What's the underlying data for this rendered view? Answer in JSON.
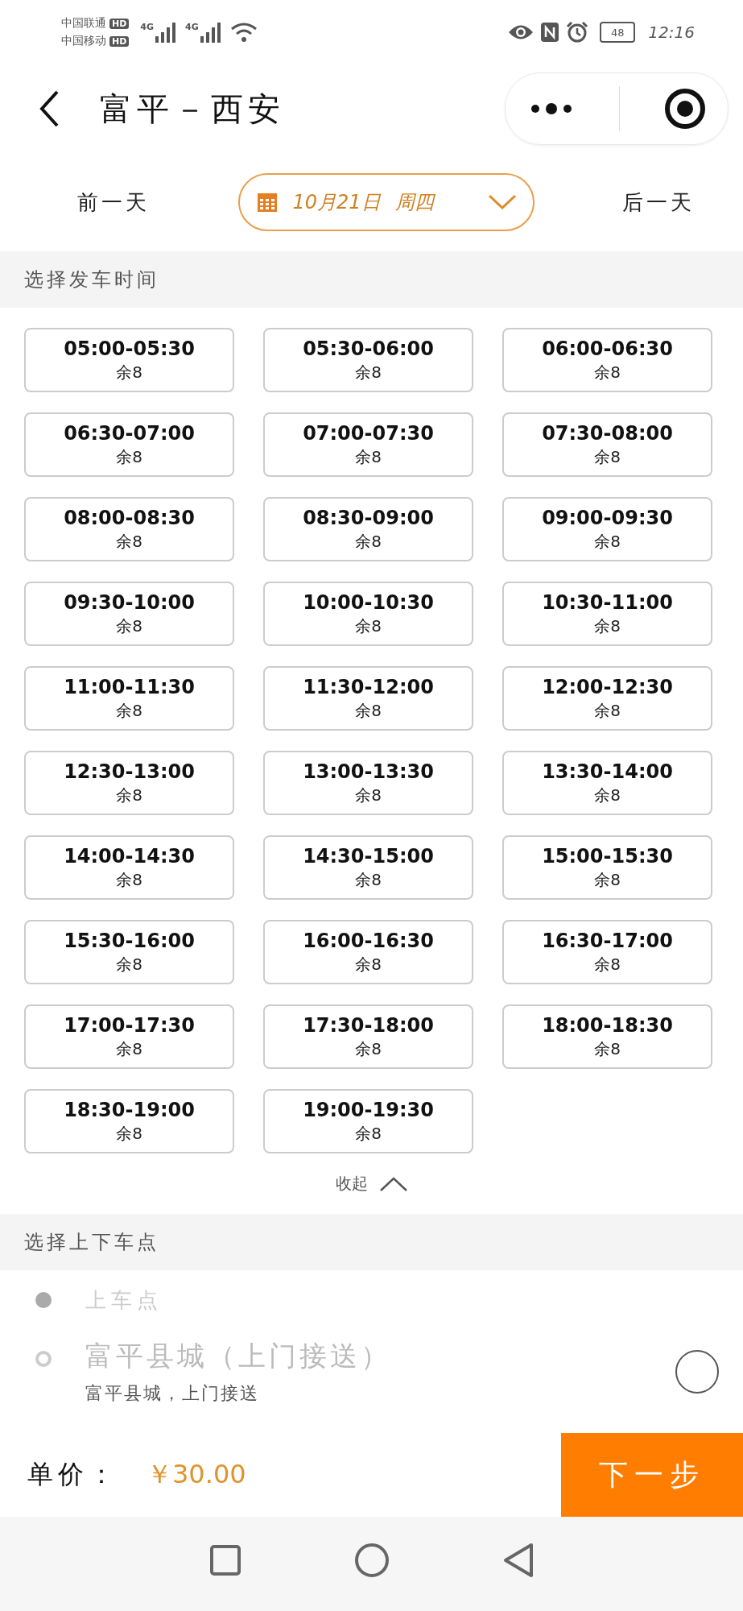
{
  "status_bar": {
    "carriers": [
      {
        "name": "中国联通",
        "badge": "HD",
        "network": "4G"
      },
      {
        "name": "中国移动",
        "badge": "HD",
        "network": "4G"
      }
    ],
    "battery": "48",
    "time": "12:16"
  },
  "header": {
    "title": "富平－西安"
  },
  "date_bar": {
    "prev": "前一天",
    "date": "10月21日",
    "weekday": "周四",
    "next": "后一天"
  },
  "time_section": {
    "title": "选择发车时间",
    "collapse": "收起",
    "slots": [
      {
        "time": "05:00-05:30",
        "remaining": "余8",
        "selected": false
      },
      {
        "time": "05:30-06:00",
        "remaining": "余8",
        "selected": false
      },
      {
        "time": "06:00-06:30",
        "remaining": "余8",
        "selected": false
      },
      {
        "time": "06:30-07:00",
        "remaining": "余8",
        "selected": false
      },
      {
        "time": "07:00-07:30",
        "remaining": "余8",
        "selected": false
      },
      {
        "time": "07:30-08:00",
        "remaining": "余8",
        "selected": false
      },
      {
        "time": "08:00-08:30",
        "remaining": "余8",
        "selected": false
      },
      {
        "time": "08:30-09:00",
        "remaining": "余8",
        "selected": false
      },
      {
        "time": "09:00-09:30",
        "remaining": "余8",
        "selected": false
      },
      {
        "time": "09:30-10:00",
        "remaining": "余8",
        "selected": false
      },
      {
        "time": "10:00-10:30",
        "remaining": "余8",
        "selected": false
      },
      {
        "time": "10:30-11:00",
        "remaining": "余8",
        "selected": false
      },
      {
        "time": "11:00-11:30",
        "remaining": "余8",
        "selected": false
      },
      {
        "time": "11:30-12:00",
        "remaining": "余8",
        "selected": false
      },
      {
        "time": "12:00-12:30",
        "remaining": "余8",
        "selected": false
      },
      {
        "time": "12:30-13:00",
        "remaining": "余8",
        "selected": false
      },
      {
        "time": "13:00-13:30",
        "remaining": "余8",
        "selected": false
      },
      {
        "time": "13:30-14:00",
        "remaining": "余8",
        "selected": false
      },
      {
        "time": "14:00-14:30",
        "remaining": "余8",
        "selected": false
      },
      {
        "time": "14:30-15:00",
        "remaining": "余8",
        "selected": false
      },
      {
        "time": "15:00-15:30",
        "remaining": "余8",
        "selected": false
      },
      {
        "time": "15:30-16:00",
        "remaining": "余8",
        "selected": false
      },
      {
        "time": "16:00-16:30",
        "remaining": "余8",
        "selected": false
      },
      {
        "time": "16:30-17:00",
        "remaining": "余8",
        "selected": false
      },
      {
        "time": "17:00-17:30",
        "remaining": "余8",
        "selected": false
      },
      {
        "time": "17:30-18:00",
        "remaining": "余8",
        "selected": false
      },
      {
        "time": "18:00-18:30",
        "remaining": "余8",
        "selected": false
      },
      {
        "time": "18:30-19:00",
        "remaining": "余8",
        "selected": false
      },
      {
        "time": "19:00-19:30",
        "remaining": "余8",
        "selected": false
      }
    ]
  },
  "stop_section": {
    "title": "选择上下车点",
    "group_label": "上车点",
    "options": [
      {
        "name": "富平县城（上门接送）",
        "detail": "富平县城，上门接送",
        "selected": false
      }
    ]
  },
  "footer": {
    "price_label": "单价：",
    "price": "￥30.00",
    "next_button": "下一步"
  }
}
